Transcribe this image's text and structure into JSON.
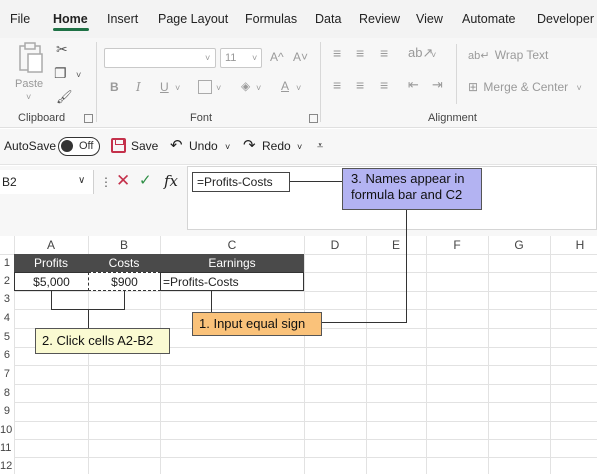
{
  "menu": {
    "items": [
      "File",
      "Home",
      "Insert",
      "Page Layout",
      "Formulas",
      "Data",
      "Review",
      "View",
      "Automate",
      "Developer"
    ],
    "active": "Home"
  },
  "ribbon": {
    "clipboard": {
      "label": "Clipboard",
      "paste_label": "Paste"
    },
    "font": {
      "label": "Font",
      "size": "11",
      "bold": "B",
      "italic": "I",
      "underline": "U",
      "grow": "A^",
      "shrink": "A˅",
      "font_color": "A"
    },
    "alignment": {
      "label": "Alignment",
      "wrap_text": "Wrap Text",
      "merge_center": "Merge & Center"
    }
  },
  "qat": {
    "autosave_label": "AutoSave",
    "toggle_state": "Off",
    "save_label": "Save",
    "undo_label": "Undo",
    "redo_label": "Redo"
  },
  "formula_bar": {
    "name_box": "B2",
    "fx": "fx",
    "formula": "=Profits-Costs"
  },
  "grid": {
    "columns": [
      "A",
      "B",
      "C",
      "D",
      "E",
      "F",
      "G",
      "H"
    ],
    "rows": [
      "1",
      "2",
      "3",
      "4",
      "5",
      "6",
      "7",
      "8",
      "9",
      "10",
      "11",
      "12"
    ],
    "headers": {
      "A1": "Profits",
      "B1": "Costs",
      "C1": "Earnings"
    },
    "cells": {
      "A2": "$5,000",
      "B2": "$900",
      "C2": "=Profits-Costs"
    }
  },
  "callouts": {
    "step1": "1. Input equal sign",
    "step2": "2. Click cells A2-B2",
    "step3_line1": "3. Names appear in",
    "step3_line2": "formula bar and C2"
  },
  "colors": {
    "accent": "#1e7145",
    "header_fill": "#4a4a4a",
    "callout_purple": "#b3b3f2",
    "callout_orange": "#fac27a",
    "callout_yellow": "#fafad2"
  }
}
